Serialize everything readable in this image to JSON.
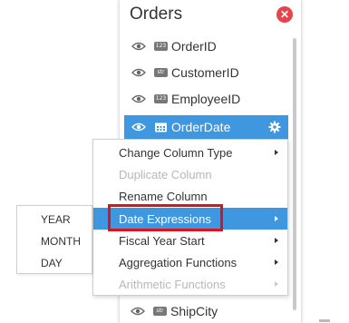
{
  "panel": {
    "title": "Orders",
    "close_glyph": "✕",
    "columns": [
      {
        "name": "OrderID",
        "type": "123"
      },
      {
        "name": "CustomerID",
        "type": "str"
      },
      {
        "name": "EmployeeID",
        "type": "123"
      },
      {
        "name": "OrderDate",
        "type": "date"
      }
    ],
    "bottom_column": {
      "name": "ShipCity",
      "type": "str"
    }
  },
  "context_menu": {
    "items": [
      {
        "label": "Change Column Type",
        "submenu": true,
        "disabled": false
      },
      {
        "label": "Duplicate Column",
        "submenu": false,
        "disabled": true
      },
      {
        "label": "Rename Column",
        "submenu": false,
        "disabled": false
      },
      {
        "label": "Date Expressions",
        "submenu": true,
        "disabled": false,
        "active": true
      },
      {
        "label": "Fiscal Year Start",
        "submenu": true,
        "disabled": false
      },
      {
        "label": "Aggregation Functions",
        "submenu": true,
        "disabled": false
      },
      {
        "label": "Arithmetic Functions",
        "submenu": true,
        "disabled": true
      }
    ]
  },
  "date_submenu": {
    "items": [
      "YEAR",
      "MONTH",
      "DAY"
    ]
  },
  "colors": {
    "accent": "#3f97e0",
    "highlight": "#d8141e",
    "close": "#e8434a"
  }
}
